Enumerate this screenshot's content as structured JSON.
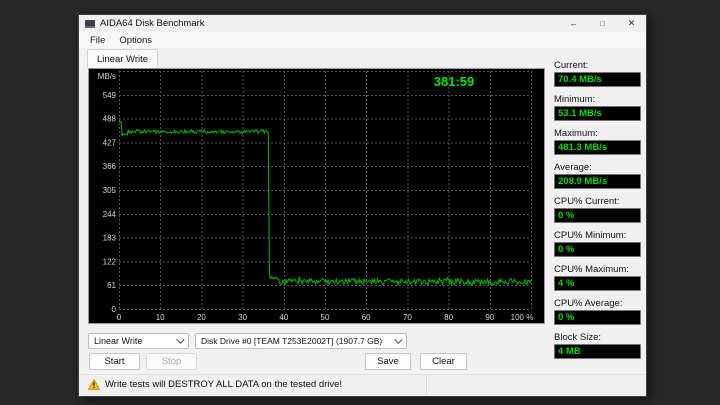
{
  "window": {
    "title": "AIDA64 Disk Benchmark",
    "controls": {
      "minimize": "–",
      "maximize": "□",
      "close": "✕"
    },
    "menu": [
      "File",
      "Options"
    ],
    "tab": "Linear Write"
  },
  "chart_data": {
    "type": "line",
    "title": "Linear Write benchmark trace",
    "y_unit": "MB/s",
    "y_ticks": [
      0,
      61,
      122,
      183,
      244,
      305,
      366,
      427,
      488,
      549
    ],
    "y_max": 610,
    "x_ticks": [
      "0",
      "10",
      "20",
      "30",
      "40",
      "50",
      "60",
      "70",
      "80",
      "90",
      "100 %"
    ],
    "x_range": [
      0,
      100
    ],
    "elapsed_time": "381:59",
    "grid": true,
    "legend": "none",
    "bg_color": "#000000",
    "grid_color": "#565656",
    "line_color": "#00bb00",
    "segments": [
      {
        "x_start": 0,
        "x_end": 0.5,
        "value": 481,
        "noise": 2
      },
      {
        "x_start": 0.5,
        "x_end": 2.2,
        "value": 447,
        "noise": 3
      },
      {
        "x_start": 2.2,
        "x_end": 36.4,
        "value": 455,
        "noise": 5
      },
      {
        "x_start": 36.4,
        "x_end": 36.7,
        "value": 86,
        "noise": 2
      },
      {
        "x_start": 36.7,
        "x_end": 38.5,
        "value": 79,
        "noise": 4
      },
      {
        "x_start": 38.5,
        "x_end": 100,
        "value": 70,
        "noise": 8,
        "spikes": true
      }
    ],
    "summary": {
      "current": 70.4,
      "minimum": 53.1,
      "maximum": 481.3,
      "average": 208.9,
      "unit": "MB/s"
    }
  },
  "stats": [
    {
      "label": "Current:",
      "value": "70.4 MB/s"
    },
    {
      "label": "Minimum:",
      "value": "53.1 MB/s"
    },
    {
      "label": "Maximum:",
      "value": "481.3 MB/s"
    },
    {
      "label": "Average:",
      "value": "208.9 MB/s"
    },
    {
      "label": "CPU% Current:",
      "value": "0 %"
    },
    {
      "label": "CPU% Minimum:",
      "value": "0 %"
    },
    {
      "label": "CPU% Maximum:",
      "value": "4 %"
    },
    {
      "label": "CPU% Average:",
      "value": "0 %"
    },
    {
      "label": "Block Size:",
      "value": "4 MB"
    }
  ],
  "controls": {
    "test_select": "Linear Write",
    "drive_select": "Disk Drive #0  [TEAM T253E2002T]  (1907.7 GB)",
    "start": "Start",
    "stop": "Stop",
    "save": "Save",
    "clear": "Clear"
  },
  "status_bar": {
    "warning": "Write tests will DESTROY ALL DATA on the tested drive!"
  },
  "colors": {
    "accent_green": "#00dc00",
    "timer_green": "#00e400",
    "warning_yellow": "#ffc20e",
    "desktop_bg": "#282828",
    "window_bg": "#f0f0f0"
  }
}
